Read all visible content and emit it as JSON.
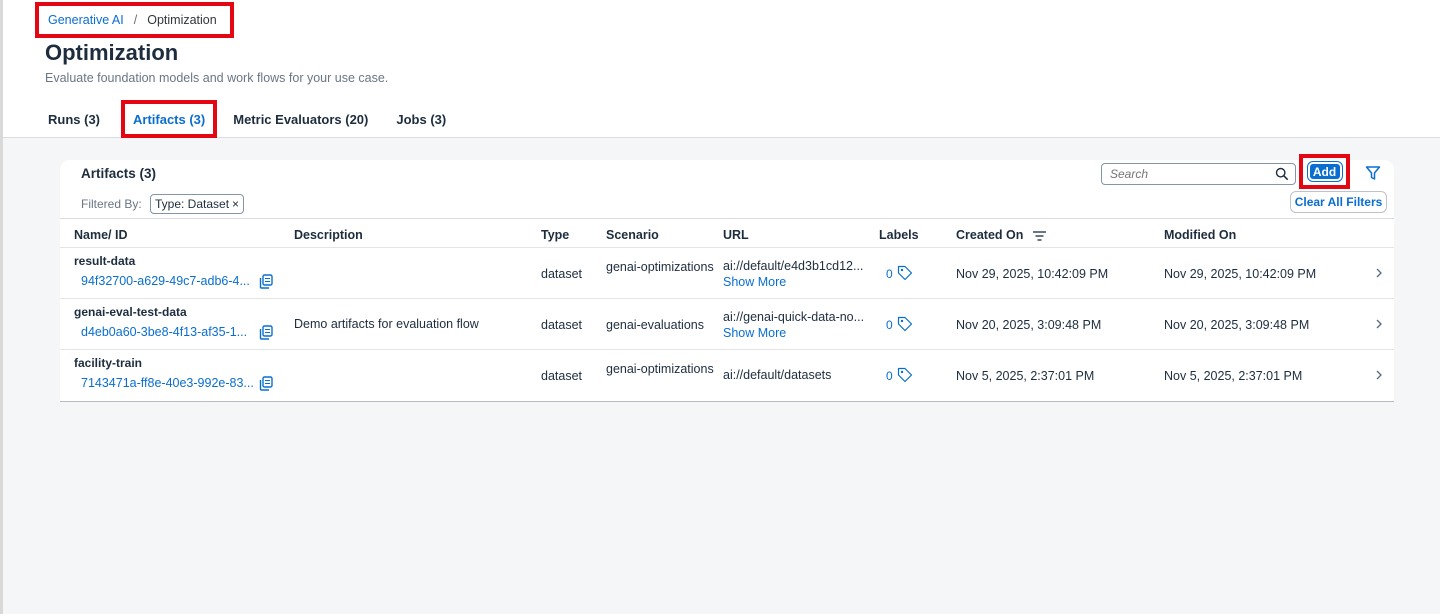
{
  "breadcrumb": {
    "root": "Generative AI",
    "separator": "/",
    "current": "Optimization"
  },
  "page": {
    "title": "Optimization",
    "subtitle": "Evaluate foundation models and work flows for your use case."
  },
  "tabs": [
    {
      "label": "Runs (3)"
    },
    {
      "label": "Artifacts (3)"
    },
    {
      "label": "Metric Evaluators (20)"
    },
    {
      "label": "Jobs (3)"
    }
  ],
  "card": {
    "title": "Artifacts (3)",
    "filtered_by_label": "Filtered By:",
    "chip_label": "Type: Dataset",
    "chip_close": "×",
    "search_placeholder": "Search",
    "add_label": "Add",
    "clear_filters_label": "Clear All Filters"
  },
  "columns": {
    "name": "Name/ ID",
    "description": "Description",
    "type": "Type",
    "scenario": "Scenario",
    "url": "URL",
    "labels": "Labels",
    "created": "Created On",
    "modified": "Modified On"
  },
  "rows": [
    {
      "name": "result-data",
      "id": "94f32700-a629-49c7-adb6-4...",
      "description": "",
      "type": "dataset",
      "scenario": "genai-optimizations",
      "url": "ai://default/e4d3b1cd12...",
      "show_more": "Show More",
      "labels": "0",
      "created": "Nov 29, 2025, 10:42:09 PM",
      "modified": "Nov 29, 2025, 10:42:09 PM"
    },
    {
      "name": "genai-eval-test-data",
      "id": "d4eb0a60-3be8-4f13-af35-1...",
      "description": "Demo artifacts for evaluation flow",
      "type": "dataset",
      "scenario": "genai-evaluations",
      "url": "ai://genai-quick-data-no...",
      "show_more": "Show More",
      "labels": "0",
      "created": "Nov 20, 2025, 3:09:48 PM",
      "modified": "Nov 20, 2025, 3:09:48 PM"
    },
    {
      "name": "facility-train",
      "id": "7143471a-ff8e-40e3-992e-83...",
      "description": "",
      "type": "dataset",
      "scenario": "genai-optimizations",
      "url": "ai://default/datasets",
      "labels": "0",
      "created": "Nov 5, 2025, 2:37:01 PM",
      "modified": "Nov 5, 2025, 2:37:01 PM"
    }
  ],
  "colors": {
    "accent": "#0a6ed1",
    "highlight": "#e30613",
    "background": "#f5f6f7"
  }
}
